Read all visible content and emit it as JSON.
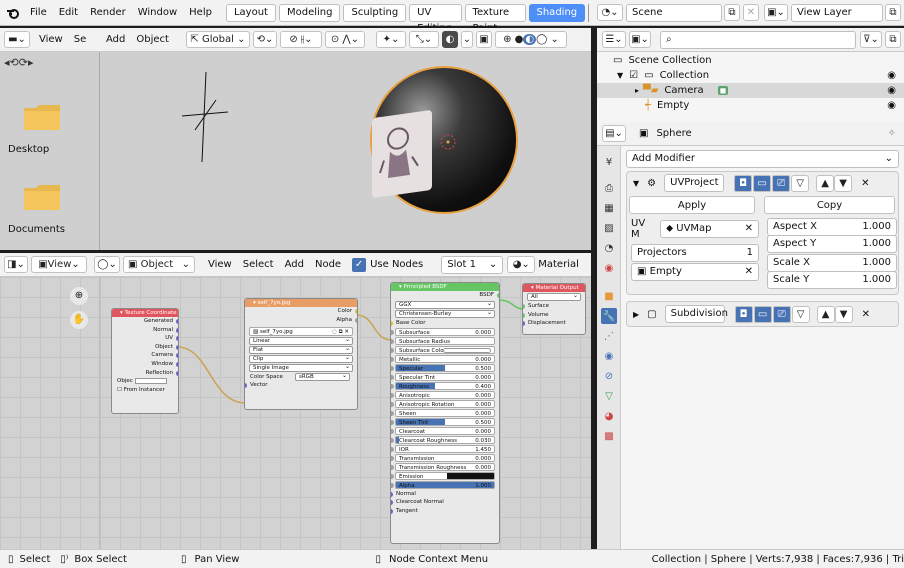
{
  "topbar": {
    "menus": [
      "File",
      "Edit",
      "Render",
      "Window",
      "Help"
    ],
    "workspaces": [
      "Layout",
      "Modeling",
      "Sculpting",
      "UV Editing",
      "Texture Paint",
      "Shading"
    ],
    "active_workspace": "Shading",
    "scene_label": "Scene",
    "view_layer_label": "View Layer"
  },
  "file_browser": {
    "header": {
      "view": "View",
      "select": "Se"
    },
    "folders": [
      "Desktop",
      "Documents"
    ]
  },
  "viewport": {
    "menus": [
      "Add",
      "Object"
    ],
    "transform_orientation": "Global"
  },
  "outliner": {
    "search_placeholder": "",
    "root": "Scene Collection",
    "collection": "Collection",
    "items": [
      "Camera",
      "Empty"
    ]
  },
  "properties": {
    "object_name": "Sphere",
    "add_modifier": "Add Modifier",
    "uvproject": {
      "name": "UVProject",
      "apply": "Apply",
      "copy": "Copy",
      "uvmap_label": "UV M",
      "uvmap_value": "UVMap",
      "aspect_x_label": "Aspect X",
      "aspect_x": "1.000",
      "aspect_y_label": "Aspect Y",
      "aspect_y": "1.000",
      "projectors_label": "Projectors",
      "projectors": "1",
      "scale_x_label": "Scale X",
      "scale_x": "1.000",
      "scale_y_label": "Scale Y",
      "scale_y": "1.000",
      "projector_object": "Empty"
    },
    "subdivision": {
      "name": "Subdivision"
    }
  },
  "node_editor": {
    "header": {
      "mode": "View",
      "object": "Object",
      "menus": [
        "View",
        "Select",
        "Add",
        "Node"
      ],
      "use_nodes": "Use Nodes",
      "slot": "Slot 1",
      "material": "Material"
    },
    "tex_coord": {
      "title": "Texture Coordinate",
      "outputs": [
        "Generated",
        "Normal",
        "UV",
        "Object",
        "Camera",
        "Window",
        "Reflection"
      ],
      "object_label": "Objec",
      "from_instancer": "From Instancer"
    },
    "image": {
      "title": "self_7yo.jpg",
      "outputs": [
        "Color",
        "Alpha"
      ],
      "file": "self_7yo.jpg",
      "interpolation": "Linear",
      "projection": "Flat",
      "extension": "Clip",
      "source": "Single Image",
      "color_space_label": "Color Space",
      "color_space": "sRGB",
      "vector": "Vector"
    },
    "bsdf": {
      "title": "Principled BSDF",
      "output": "BSDF",
      "distribution": "GGX",
      "subsurface_method": "Christensen-Burley",
      "base_color": "Base Color",
      "params": [
        {
          "name": "Subsurface",
          "value": "0.000",
          "fill": 0
        },
        {
          "name": "Subsurface Radius",
          "value": "",
          "fill": 0,
          "kind": "select"
        },
        {
          "name": "Subsurface Color",
          "value": "",
          "fill": 0,
          "kind": "color"
        },
        {
          "name": "Metallic",
          "value": "0.000",
          "fill": 0
        },
        {
          "name": "Specular",
          "value": "0.500",
          "fill": 0.5
        },
        {
          "name": "Specular Tint",
          "value": "0.000",
          "fill": 0
        },
        {
          "name": "Roughness",
          "value": "0.400",
          "fill": 0.4
        },
        {
          "name": "Anisotropic",
          "value": "0.000",
          "fill": 0
        },
        {
          "name": "Anisotropic Rotation",
          "value": "0.000",
          "fill": 0
        },
        {
          "name": "Sheen",
          "value": "0.000",
          "fill": 0
        },
        {
          "name": "Sheen Tint",
          "value": "0.500",
          "fill": 0.5
        },
        {
          "name": "Clearcoat",
          "value": "0.000",
          "fill": 0
        },
        {
          "name": "Clearcoat Roughness",
          "value": "0.030",
          "fill": 0.03
        },
        {
          "name": "IOR",
          "value": "1.450",
          "fill": 0
        },
        {
          "name": "Transmission",
          "value": "0.000",
          "fill": 0
        },
        {
          "name": "Transmission Roughness",
          "value": "0.000",
          "fill": 0
        },
        {
          "name": "Emission",
          "value": "",
          "fill": 0,
          "kind": "black"
        },
        {
          "name": "Alpha",
          "value": "1.000",
          "fill": 1
        }
      ],
      "inputs_tail": [
        "Normal",
        "Clearcoat Normal",
        "Tangent"
      ]
    },
    "output": {
      "title": "Material Output",
      "target": "All",
      "inputs": [
        "Surface",
        "Volume",
        "Displacement"
      ]
    }
  },
  "status": {
    "select": "Select",
    "box_select": "Box Select",
    "pan": "Pan View",
    "context": "Node Context Menu",
    "info": "Collection | Sphere | Verts:7,938 | Faces:7,936 | Tri"
  },
  "colors": {
    "accent": "#4d8ef7",
    "node_blue": "#4772b3",
    "texcoord_head": "#e0565e",
    "image_head": "#e89d66",
    "bsdf_head": "#65c763",
    "output_head": "#e0565e"
  }
}
